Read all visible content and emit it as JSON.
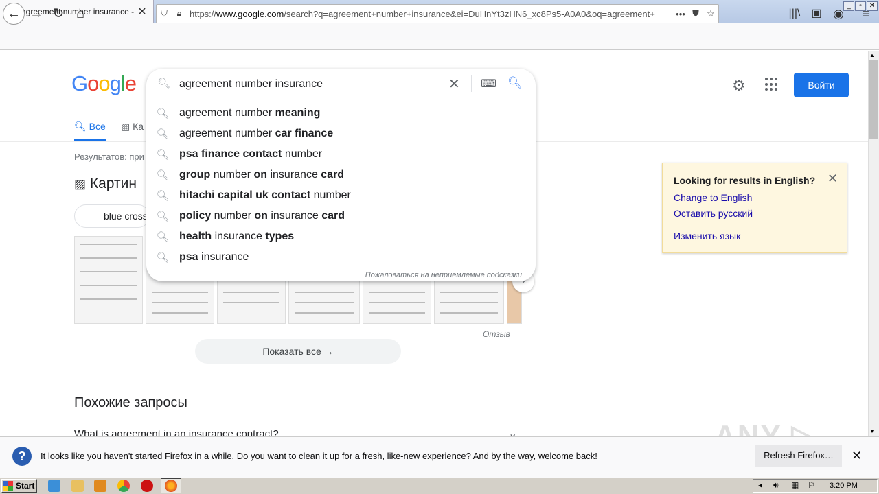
{
  "browser": {
    "tab_title": "agreement number insurance - По",
    "new_tab_glyph": "+",
    "url_domain": "www.google.com",
    "url_prefix": "https://",
    "url_rest": "/search?q=agreement+number+insurance&ei=DuHnYt3zHN6_xc8Ps5-A0A0&oq=agreement+",
    "more_label": "•••"
  },
  "google": {
    "logo": "Google",
    "query": "agreement number insurance",
    "suggestions": [
      {
        "pre": "agreement number ",
        "bold": "meaning",
        "post": ""
      },
      {
        "pre": "agreement number ",
        "bold": "car finance",
        "post": ""
      },
      {
        "pre": "",
        "bold": "psa finance contact",
        "post": " number"
      },
      {
        "pre": "",
        "bold": "group",
        "post": " number ",
        "bold2": "on",
        "post2": " insurance ",
        "bold3": "card"
      },
      {
        "pre": "",
        "bold": "hitachi capital uk contact",
        "post": " number"
      },
      {
        "pre": "",
        "bold": "policy",
        "post": " number ",
        "bold2": "on",
        "post2": " insurance ",
        "bold3": "card"
      },
      {
        "pre": "",
        "bold": "health",
        "post": " insurance ",
        "bold2": "types",
        "post2": ""
      },
      {
        "pre": "",
        "bold": "psa",
        "post": " insurance"
      }
    ],
    "report_label": "Пожаловаться на неприемлемые подсказки",
    "signin_label": "Войти",
    "tab_all": "Все",
    "tab_images": "Ка",
    "results_text": "Результатов: при",
    "images_heading": "Картин",
    "chip_label": "blue cross",
    "feedback_label": "Отзыв",
    "show_all_label": "Показать все",
    "related_heading": "Похожие запросы",
    "related_q1": "What is agreement in an insurance contract?"
  },
  "lang_card": {
    "title": "Looking for results in English?",
    "link1": "Change to English",
    "link2": "Оставить русский",
    "link3": "Изменить язык"
  },
  "notification": {
    "text": "It looks like you haven't started Firefox in a while. Do you want to clean it up for a fresh, like-new experience? And by the way, welcome back!",
    "button": "Refresh Firefox…"
  },
  "watermark": "ANY.RUN",
  "taskbar": {
    "start_label": "Start",
    "clock": "3:20 PM"
  }
}
